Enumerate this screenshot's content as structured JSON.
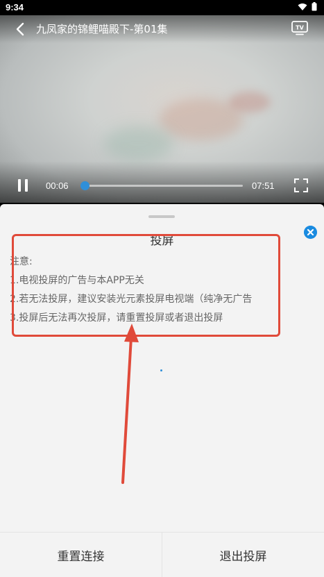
{
  "status_bar": {
    "time": "9:34"
  },
  "player": {
    "title": "九凤家的锦鲤喵殿下-第01集",
    "current_time": "00:06",
    "total_time": "07:51",
    "progress": 0.013,
    "accent_color": "#2f8fd8"
  },
  "cast_sheet": {
    "title": "投屏",
    "notice": [
      "注意:",
      "1.电视投屏的广告与本APP无关",
      "2.若无法投屏，建议安装光元素投屏电视端（纯净无广告",
      "3.投屏后无法再次投屏，请重置投屏或者退出投屏"
    ],
    "reset_button": "重置连接",
    "exit_button": "退出投屏"
  },
  "annotation_color": "#e04a3a"
}
